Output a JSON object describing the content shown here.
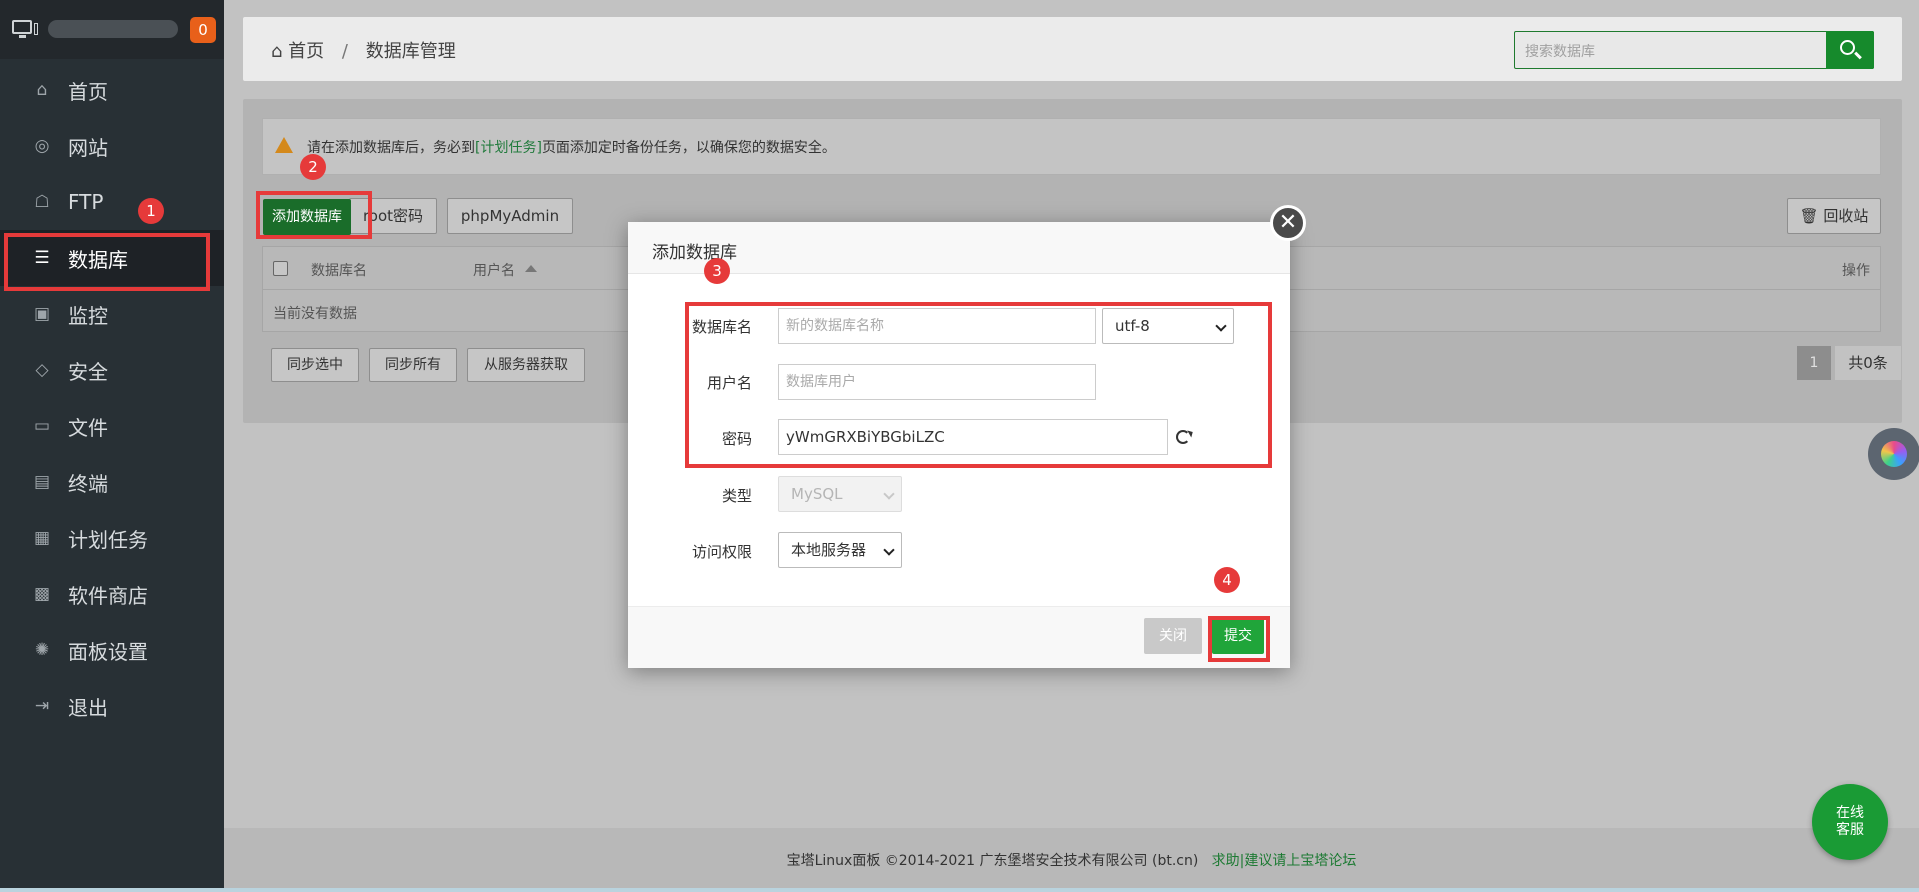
{
  "sidebar": {
    "badge": "0",
    "items": [
      {
        "label": "首页",
        "icon": "home-icon",
        "glyph": "⌂"
      },
      {
        "label": "网站",
        "icon": "globe-icon",
        "glyph": "◎"
      },
      {
        "label": "FTP",
        "icon": "ftp-icon",
        "glyph": "☖"
      },
      {
        "label": "数据库",
        "icon": "database-icon",
        "glyph": "☰",
        "active": true
      },
      {
        "label": "监控",
        "icon": "monitor-icon",
        "glyph": "▣"
      },
      {
        "label": "安全",
        "icon": "shield-icon",
        "glyph": "◇"
      },
      {
        "label": "文件",
        "icon": "folder-icon",
        "glyph": "▭"
      },
      {
        "label": "终端",
        "icon": "terminal-icon",
        "glyph": "▤"
      },
      {
        "label": "计划任务",
        "icon": "calendar-icon",
        "glyph": "▦"
      },
      {
        "label": "软件商店",
        "icon": "apps-icon",
        "glyph": "▩"
      },
      {
        "label": "面板设置",
        "icon": "gear-icon",
        "glyph": "✺"
      },
      {
        "label": "退出",
        "icon": "logout-icon",
        "glyph": "⇥"
      }
    ]
  },
  "header": {
    "breadcrumb_home": "首页",
    "breadcrumb_sep": "/",
    "breadcrumb_current": "数据库管理",
    "search_placeholder": "搜索数据库"
  },
  "notice": {
    "before": "请在添加数据库后，务必到",
    "link": "[计划任务]",
    "after": "页面添加定时备份任务，以确保您的数据安全。"
  },
  "toolbar": {
    "add_db": "添加数据库",
    "root_pw": "root密码",
    "phpmyadmin": "phpMyAdmin",
    "recycle": "回收站"
  },
  "table": {
    "col_name": "数据库名",
    "col_user": "用户名",
    "col_ops": "操作",
    "empty": "当前没有数据"
  },
  "sync": {
    "sync_selected": "同步选中",
    "sync_all": "同步所有",
    "fetch": "从服务器获取"
  },
  "pagination": {
    "current": "1",
    "total": "共0条"
  },
  "dialog": {
    "title": "添加数据库",
    "db_name_label": "数据库名",
    "db_name_placeholder": "新的数据库名称",
    "charset": "utf-8",
    "user_label": "用户名",
    "user_placeholder": "数据库用户",
    "password_label": "密码",
    "password_value": "yWmGRXBiYBGbiLZC",
    "type_label": "类型",
    "type_value": "MySQL",
    "access_label": "访问权限",
    "access_value": "本地服务器",
    "close_btn": "关闭",
    "submit_btn": "提交",
    "close_x": "✕"
  },
  "footer": {
    "text": "宝塔Linux面板 ©2014-2021 广东堡塔安全技术有限公司 (bt.cn)",
    "link": "求助|建议请上宝塔论坛"
  },
  "float": {
    "online_line1": "在线",
    "online_line2": "客服"
  },
  "annotations": {
    "n1": "1",
    "n2": "2",
    "n3": "3",
    "n4": "4",
    "color": "#e63a3a"
  }
}
